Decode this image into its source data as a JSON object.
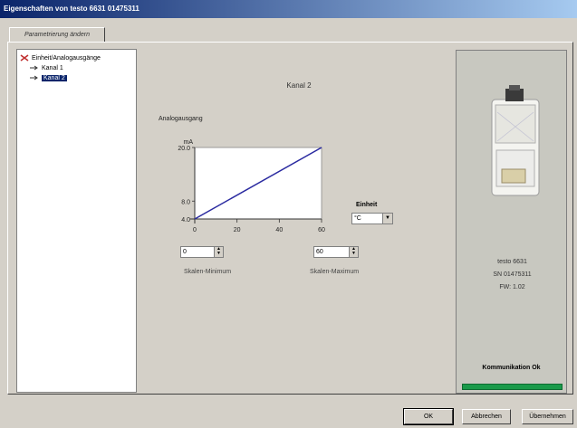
{
  "window": {
    "title": "Eigenschaften von testo 6631  01475311"
  },
  "tabs": [
    {
      "label": "Parametrierung ändern"
    }
  ],
  "tree": {
    "root": "Einheit/Analogausgänge",
    "children": [
      "Kanal 1",
      "Kanal 2"
    ],
    "selected_index": 1
  },
  "main": {
    "channel_title": "Kanal 2",
    "chart_heading": "Analogausgang",
    "scale_min_label": "Skalen-Minimum",
    "scale_max_label": "Skalen-Maximum",
    "scale_min_value": "0",
    "scale_max_value": "60",
    "unit_label": "Einheit",
    "unit_value": "°C"
  },
  "chart_data": {
    "type": "line",
    "y_unit": "mA",
    "y_ticks": [
      "20.0",
      "8.0",
      "4.0"
    ],
    "x_ticks": [
      "0",
      "20",
      "40",
      "60"
    ],
    "xlim": [
      0,
      60
    ],
    "ylim": [
      4,
      20
    ],
    "series": [
      {
        "x": [
          0,
          60
        ],
        "y": [
          4,
          20
        ]
      }
    ],
    "line_color": "#2a2aa0"
  },
  "device": {
    "model": "testo 6631",
    "serial": "SN 01475311",
    "firmware": "FW: 1.02",
    "comm_status": "Kommunikation Ok",
    "comm_color": "#1a9a4a"
  },
  "buttons": {
    "ok": "OK",
    "cancel": "Abbrechen",
    "apply": "Übernehmen"
  }
}
